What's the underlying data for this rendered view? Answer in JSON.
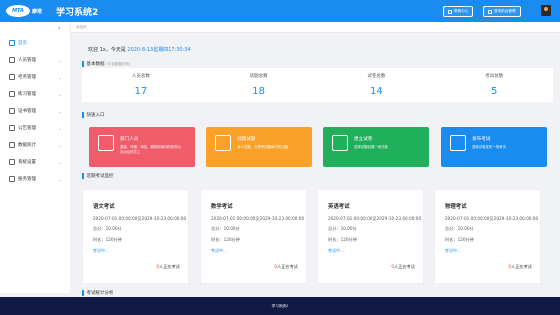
{
  "header": {
    "logo_badge": "MTA",
    "logo_text": "摩塔",
    "title": "学习系统2",
    "buttons": [
      {
        "label": "帮助中心",
        "icon": "help-icon"
      },
      {
        "label": "登录前台管理",
        "icon": "login-icon"
      }
    ]
  },
  "sidebar": {
    "collapse": "‹",
    "items": [
      {
        "label": "首页",
        "active": true
      },
      {
        "label": "人员管理"
      },
      {
        "label": "考务管理"
      },
      {
        "label": "练习管理"
      },
      {
        "label": "证书管理"
      },
      {
        "label": "公告管理"
      },
      {
        "label": "数据统计"
      },
      {
        "label": "系统设置"
      },
      {
        "label": "服务管理"
      }
    ]
  },
  "breadcrumb": "欢迎页",
  "welcome": {
    "prefix": "欢迎 1x，今天是",
    "datetime": "2020-8-13星期四17:30:34"
  },
  "basic": {
    "title": "基本数据",
    "note": "(平台数据分析)",
    "stats": [
      {
        "label": "人员总数",
        "value": "17"
      },
      {
        "label": "试题总数",
        "value": "18"
      },
      {
        "label": "试卷总数",
        "value": "14"
      },
      {
        "label": "考试总数",
        "value": "5"
      }
    ]
  },
  "quick": {
    "title": "快速入口",
    "items": [
      {
        "title": "部门人员",
        "desc": "直接、详细、添加、删除和调动的机构以及对应的员工",
        "color": "#f15c6a"
      },
      {
        "title": "创建试题",
        "desc": "多人试题、方便考试题库内的试题",
        "color": "#faa12a"
      },
      {
        "title": "建立试卷",
        "desc": "选择试题创建一张试卷",
        "color": "#20b05b"
      },
      {
        "title": "发布考试",
        "desc": "选择试卷发布一场考试",
        "color": "#1a8cf0"
      }
    ]
  },
  "monitor": {
    "title": "近期考试监控",
    "exams": [
      {
        "name": "语文考试",
        "time": "2020-07-01 00:00:00至2029-10-23 00:00:00",
        "score": "总分：10.00分",
        "duration": "时长：120分钟",
        "link": "考试中...",
        "count": "0",
        "count_suffix": "人正在考试"
      },
      {
        "name": "数学考试",
        "time": "2020-07-01 00:00:00至2029-10-23 00:00:00",
        "score": "总分：10.00分",
        "duration": "时长：120分钟",
        "link": "考试中...",
        "count": "0",
        "count_suffix": "人正在考试"
      },
      {
        "name": "英语考试",
        "time": "2020-07-01 00:00:00至2029-10-23 00:00:00",
        "score": "总分：10.00分",
        "duration": "时长：120分钟",
        "link": "考试中...",
        "count": "0",
        "count_suffix": "人正在考试"
      },
      {
        "name": "物理考试",
        "time": "2020-07-01 00:00:00至2029-10-23 00:00:00",
        "score": "总分：10.00分",
        "duration": "时长：120分钟",
        "link": "考试中...",
        "count": "0",
        "count_suffix": "人正在考试"
      }
    ]
  },
  "analysis": {
    "title": "考试统计分析"
  },
  "footer": "学习系统2"
}
